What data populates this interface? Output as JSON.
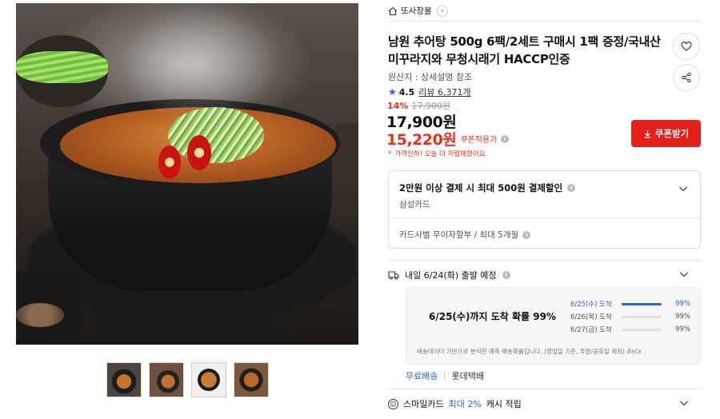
{
  "store": {
    "name": "또사장몰"
  },
  "product": {
    "title": "남원 추어탕 500g 6팩/2세트 구매시 1팩 증정/국내산 미꾸라지와 무청시래기 HACCP인증",
    "origin": "원산지 : 상세설명 참조",
    "rating": "4.5",
    "review_label": "리뷰 6,371개",
    "discount_pct": "14%",
    "original_price": "17,900원",
    "price": "17,900원",
    "coupon_price": "15,220원",
    "coupon_price_label": "쿠폰적용가",
    "price_alert": "가격인하! 오늘 더 저렴해졌어요",
    "coupon_button": "쿠폰받기"
  },
  "card_benefit": {
    "title": "2만원 이상 결제 시 최대 500원 결제할인",
    "card": "삼성카드",
    "installment": "카드사별 무이자할부 / 최대 5개월"
  },
  "shipping": {
    "departure": "내일 6/24(화) 출발 예정",
    "prediction_main": "6/25(수)까지 도착 확률 99%",
    "predictions": [
      {
        "date": "6/25(수) 도착",
        "pct": "99%",
        "value": 0.99
      },
      {
        "date": "6/26(목) 도착",
        "pct": "99%",
        "value": 0.0
      },
      {
        "date": "6/27(금) 도착",
        "pct": "99%",
        "value": 0.0
      }
    ],
    "note": "배송데이터 기반으로 분석한 예측 배송확률입니다. (영업일 기준, 주말/공휴일 제외)",
    "beta": "Beta",
    "free_shipping": "무료배송",
    "carrier": "롯데택배"
  },
  "cashback": {
    "prefix": "스마일카드",
    "highlight": "최대 2%",
    "suffix": "캐시 적립"
  },
  "colors": {
    "accent_red": "#e4321f",
    "accent_blue": "#2b66d9",
    "button_red": "#e4201b"
  },
  "icons": [
    "home-icon",
    "heart-icon",
    "share-icon",
    "star-icon",
    "info-icon",
    "download-icon",
    "truck-icon",
    "chevron-down-icon",
    "smile-icon"
  ]
}
